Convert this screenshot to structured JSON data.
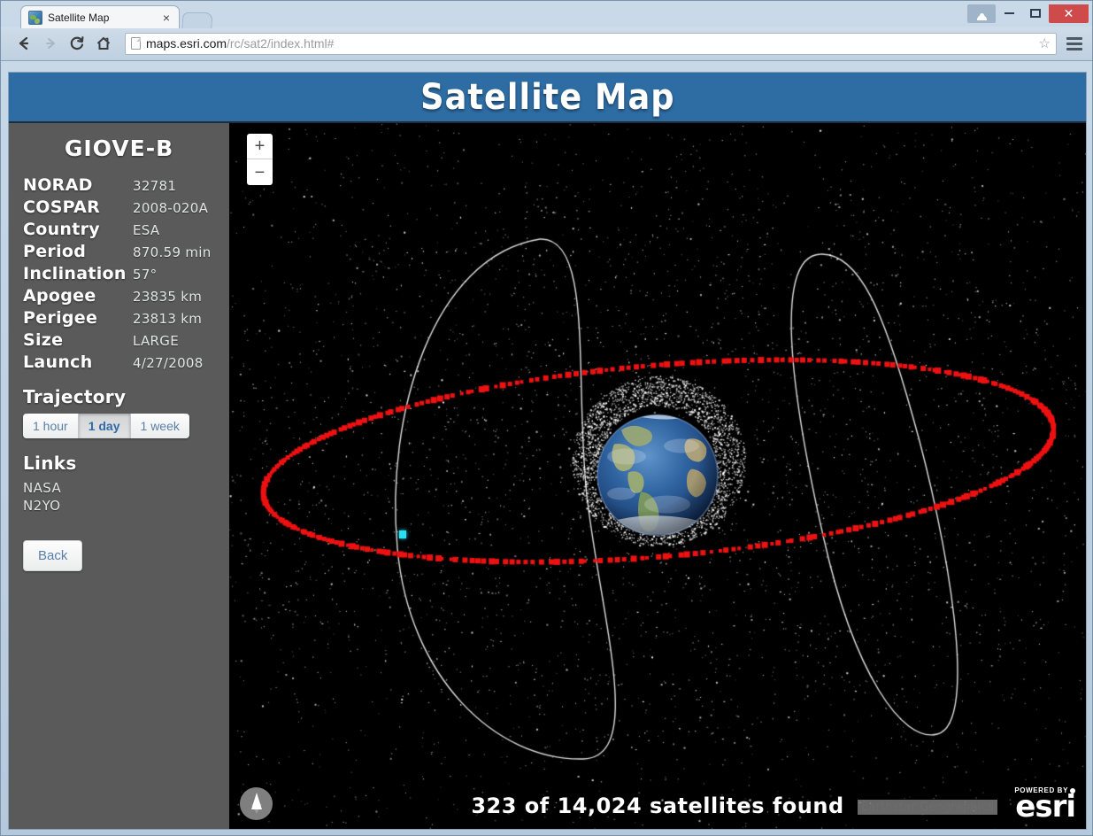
{
  "browser": {
    "tab_title": "Satellite Map",
    "tab_favicon": "globe-map-icon",
    "close_tab_glyph": "×",
    "back_glyph": "←",
    "forward_glyph": "→",
    "reload_glyph": "↻",
    "home_glyph": "⌂",
    "url_host": "maps.esri.com",
    "url_path": "/rc/sat2/index.html#",
    "url_full": "maps.esri.com/rc/sat2/index.html#",
    "star_glyph": "☆",
    "window_minimize_glyph": "–",
    "window_maximize_glyph": "□",
    "window_close_glyph": "✕"
  },
  "app": {
    "title": "Satellite Map"
  },
  "sidebar": {
    "satellite_name": "GIOVE-B",
    "info": [
      {
        "label": "NORAD",
        "value": "32781"
      },
      {
        "label": "COSPAR",
        "value": "2008-020A"
      },
      {
        "label": "Country",
        "value": "ESA"
      },
      {
        "label": "Period",
        "value": "870.59 min"
      },
      {
        "label": "Inclination",
        "value": "57°"
      },
      {
        "label": "Apogee",
        "value": "23835 km"
      },
      {
        "label": "Perigee",
        "value": "23813 km"
      },
      {
        "label": "Size",
        "value": "LARGE"
      },
      {
        "label": "Launch",
        "value": "4/27/2008"
      }
    ],
    "trajectory_heading": "Trajectory",
    "trajectory_options": [
      {
        "label": "1 hour",
        "active": false
      },
      {
        "label": "1 day",
        "active": true
      },
      {
        "label": "1 week",
        "active": false
      }
    ],
    "links_heading": "Links",
    "links": [
      {
        "label": "NASA"
      },
      {
        "label": "N2YO"
      }
    ],
    "back_label": "Back"
  },
  "map": {
    "zoom_in_glyph": "+",
    "zoom_out_glyph": "−",
    "compass": "north-arrow-icon",
    "status_text": "323 of 14,024 satellites found",
    "attribution": "Earthstar Geographics",
    "esri_powered_by": "POWERED BY",
    "esri_wordmark": "esri",
    "satellites_found": 323,
    "satellites_total": "14,024",
    "colors": {
      "banner_blue": "#2e6da4",
      "sidebar_gray": "#5a5a5a",
      "map_background": "#000000",
      "geo_belt_red": "#ee1111",
      "selected_satellite_cyan": "#29e0f2",
      "orbit_line": "#e8e8e8",
      "debris_white": "#ffffff"
    }
  }
}
